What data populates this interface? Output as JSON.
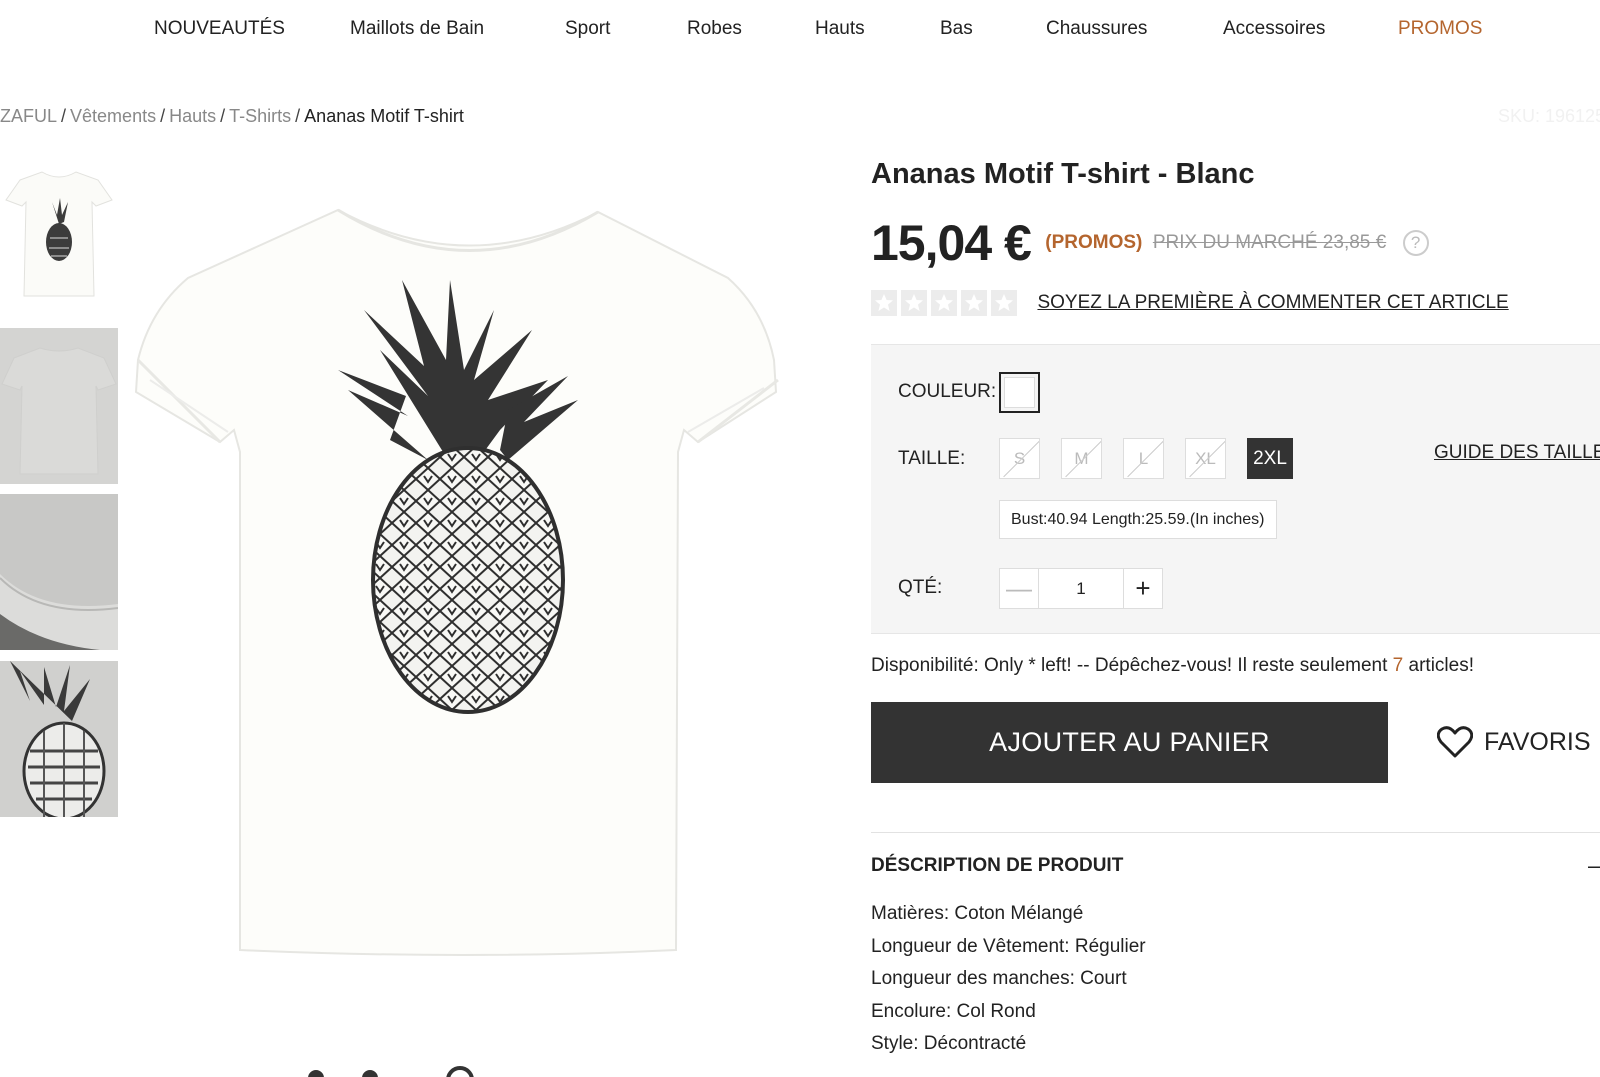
{
  "nav": {
    "items": [
      "NOUVEAUTÉS",
      "Maillots de Bain",
      "Sport",
      "Robes",
      "Hauts",
      "Bas",
      "Chaussures",
      "Accessoires",
      "PROMOS"
    ]
  },
  "breadcrumb": {
    "items": [
      "ZAFUL",
      "Vêtements",
      "Hauts",
      "T-Shirts"
    ],
    "separator": "/",
    "current": "Ananas Motif T-shirt",
    "sku": "SKU: 196125"
  },
  "product": {
    "title": "Ananas Motif T-shirt - Blanc",
    "price": "15,04 €",
    "promo_tag": "(PROMOS)",
    "market_price": "PRIX DU MARCHÉ 23,85 €",
    "help_icon": "?",
    "rating": 0,
    "rating_max": 5,
    "review_link": "SOYEZ LA PREMIÈRE À COMMENTER CET ARTICLE"
  },
  "options": {
    "color_label": "COULEUR:",
    "color_value": "#ffffff",
    "size_label": "TAILLE:",
    "sizes": [
      "S",
      "M",
      "L",
      "XL",
      "2XL"
    ],
    "selected_size": "2XL",
    "size_guide": "GUIDE DES TAILLES",
    "measurements": "Bust:40.94   Length:25.59.(In inches)",
    "qty_label": "QTÉ:",
    "qty_value": "1",
    "qty_minus": "—",
    "qty_plus": "+"
  },
  "availability": {
    "prefix": "Disponibilité: Only * left! -- Dépêchez-vous! Il reste seulement ",
    "count": "7",
    "suffix": " articles!"
  },
  "actions": {
    "add_to_cart": "AJOUTER AU PANIER",
    "favorites": "FAVORIS"
  },
  "description": {
    "heading": "DÉSCRIPTION DE PRODUIT",
    "toggle": "—",
    "lines": [
      "Matières: Coton Mélangé",
      "Longueur de Vêtement: Régulier",
      "Longueur des manches: Court",
      "Encolure: Col Rond",
      "Style: Décontracté"
    ]
  },
  "colors": {
    "promo_accent": "#b4652e",
    "button_dark": "#333333",
    "panel_bg": "#f5f5f5"
  }
}
